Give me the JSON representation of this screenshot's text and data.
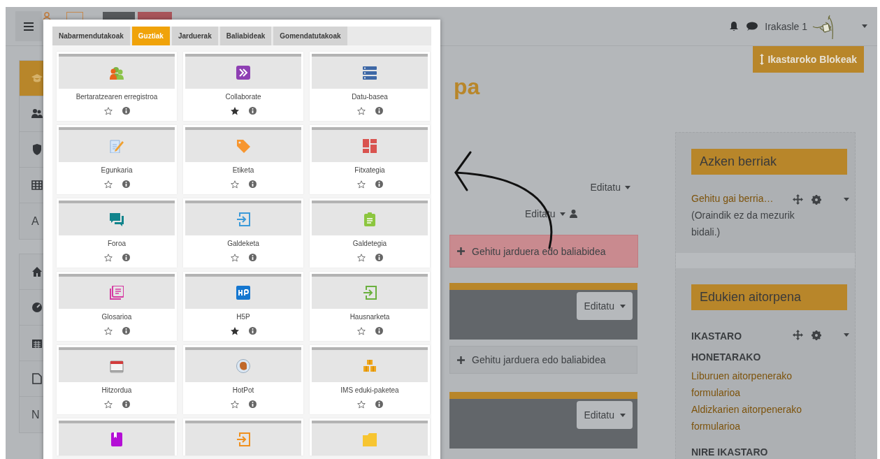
{
  "navbar": {
    "user_name": "Irakasle 1"
  },
  "sidebar": {
    "groups": [
      {
        "items": [
          {
            "selected": true
          },
          {
            "selected": false
          },
          {
            "selected": false
          },
          {
            "selected": false
          },
          {
            "label": "A",
            "selected": false
          }
        ]
      },
      {
        "items": [
          {
            "selected": false
          },
          {
            "selected": false
          },
          {
            "selected": false
          },
          {
            "selected": false
          },
          {
            "label": "N",
            "selected": false
          }
        ]
      }
    ]
  },
  "course": {
    "title": "pa",
    "edit_menus": [
      "Editatu",
      "Editatu"
    ],
    "add_buttons": [
      {
        "label": "Gehitu jarduera edo baliabidea",
        "highlighted": true
      },
      {
        "label": "Gehitu jarduera edo baliabidea",
        "highlighted": false
      }
    ],
    "sections": [
      {
        "edit": "Editatu"
      },
      {
        "edit": "Editatu"
      }
    ]
  },
  "blocks_button": "Ikastaroko Blokeak",
  "blocks": [
    {
      "title": "Azken berriak",
      "content": [
        {
          "kind": "link",
          "text": "Gehitu gai berria…"
        },
        {
          "kind": "text",
          "text": "(Oraindik ez da mezurik bidali.)"
        }
      ]
    },
    {
      "title": "Edukien aitorpena",
      "content": [
        {
          "kind": "heading",
          "text": "IKASTARO HONETARAKO"
        },
        {
          "kind": "link",
          "text": "Liburuen aitorpenerako formularioa"
        },
        {
          "kind": "link",
          "text": "Aldizkarien aitorpenerako formularioa"
        },
        {
          "kind": "heading",
          "text": "NIRE IKASTARO"
        }
      ]
    }
  ],
  "chooser": {
    "tabs": [
      {
        "label": "Nabarmendutakoak",
        "selected": false
      },
      {
        "label": "Guztiak",
        "selected": true
      },
      {
        "label": "Jarduerak",
        "selected": false
      },
      {
        "label": "Baliabideak",
        "selected": false
      },
      {
        "label": "Gomendatutakoak",
        "selected": false
      }
    ],
    "activities": [
      {
        "kind": "full",
        "name": "Bertaratzearen erregistroa",
        "starred": false
      },
      {
        "kind": "full",
        "name": "Collaborate",
        "starred": true
      },
      {
        "kind": "full",
        "name": "Datu-basea",
        "starred": false
      },
      {
        "kind": "full",
        "name": "Egunkaria",
        "starred": false
      },
      {
        "kind": "full",
        "name": "Etiketa",
        "starred": false
      },
      {
        "kind": "full",
        "name": "Fitxategia",
        "starred": false
      },
      {
        "kind": "full",
        "name": "Foroa",
        "starred": false
      },
      {
        "kind": "full",
        "name": "Galdeketa",
        "starred": false
      },
      {
        "kind": "full",
        "name": "Galdetegia",
        "starred": false
      },
      {
        "kind": "full",
        "name": "Glosarioa",
        "starred": false
      },
      {
        "kind": "full",
        "name": "H5P",
        "starred": true
      },
      {
        "kind": "full",
        "name": "Hausnarketa",
        "starred": false
      },
      {
        "kind": "full",
        "name": "Hitzordua",
        "starred": false
      },
      {
        "kind": "full",
        "name": "HotPot",
        "starred": false
      },
      {
        "kind": "full",
        "name": "IMS eduki-paketea",
        "starred": false
      },
      {
        "kind": "cut"
      },
      {
        "kind": "cut"
      },
      {
        "kind": "cut"
      }
    ]
  }
}
